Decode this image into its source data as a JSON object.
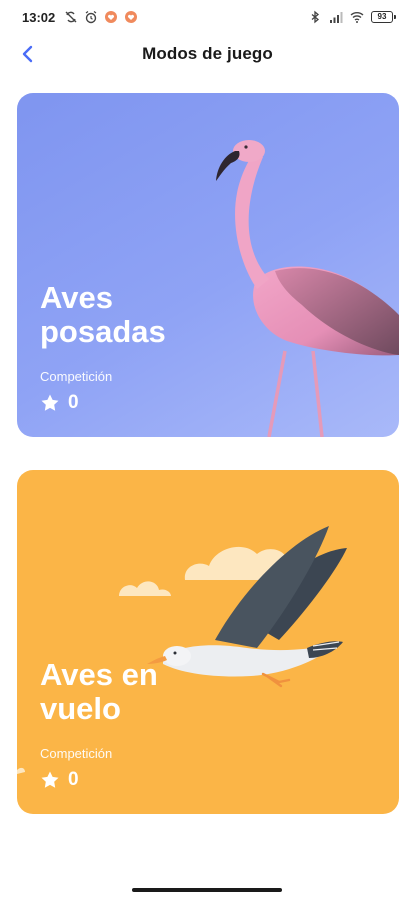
{
  "status_bar": {
    "time": "13:02",
    "battery": "93"
  },
  "header": {
    "title": "Modos de juego"
  },
  "cards": [
    {
      "title": "Aves posadas",
      "subtitle": "Competición",
      "score": "0",
      "color": "#8fa3f5"
    },
    {
      "title": "Aves en vuelo",
      "subtitle": "Competición",
      "score": "0",
      "color": "#fbb547"
    }
  ],
  "colors": {
    "accent": "#4a6cf7"
  }
}
